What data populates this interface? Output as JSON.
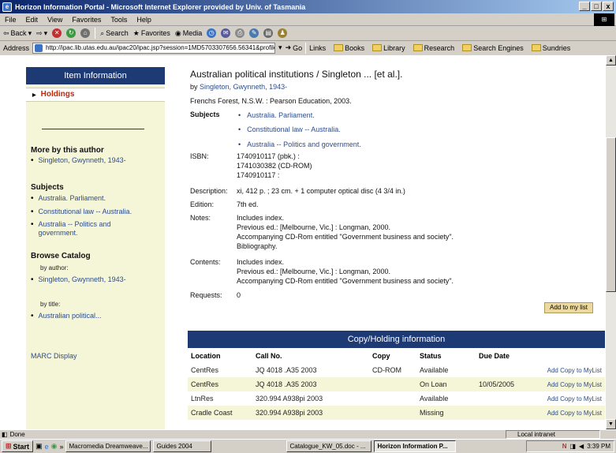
{
  "window": {
    "title": "Horizon Information Portal - Microsoft Internet Explorer provided by Univ. of Tasmania",
    "controls": [
      "_",
      "□",
      "x"
    ]
  },
  "menu": [
    "File",
    "Edit",
    "View",
    "Favorites",
    "Tools",
    "Help"
  ],
  "toolbar": {
    "back": "Back",
    "search": "Search",
    "favorites": "Favorites",
    "media": "Media"
  },
  "address": {
    "label": "Address",
    "url": "http://ipac.lib.utas.edu.au/ipac20/ipac.jsp?session=1MD5703307656.56341&profile=cent&uri=",
    "go": "Go",
    "links_label": "Links",
    "links": [
      "Books",
      "Library",
      "Research",
      "Search Engines",
      "Sundries"
    ]
  },
  "sidebar": {
    "header": "Item Information",
    "holdings": "Holdings",
    "more_by_author": "More by this author",
    "author_link": "Singleton, Gwynneth, 1943-",
    "subjects_heading": "Subjects",
    "subjects": [
      "Australia. Parliament.",
      "Constitutional law -- Australia.",
      "Australia -- Politics and government."
    ],
    "browse_heading": "Browse Catalog",
    "by_author_label": "by author:",
    "browse_author": "Singleton, Gwynneth, 1943-",
    "by_title_label": "by title:",
    "browse_title": "Australian political...",
    "marc": "MARC Display"
  },
  "record": {
    "title": "Australian political institutions / Singleton ... [et al.].",
    "by_label": "by",
    "author": "Singleton, Gwynneth, 1943-",
    "publication": "Frenchs Forest, N.S.W. : Pearson Education, 2003.",
    "subjects_label": "Subjects",
    "subjects": [
      "Australia. Parliament.",
      "Constitutional law -- Australia.",
      "Australia -- Politics and government."
    ],
    "isbn_label": "ISBN:",
    "isbn": [
      "1740910117 (pbk.) :",
      "1741030382 (CD-ROM)",
      "1740910117 :"
    ],
    "description_label": "Description:",
    "description": "xi, 412 p. ; 23 cm. + 1 computer optical disc (4 3/4 in.)",
    "edition_label": "Edition:",
    "edition": "7th ed.",
    "notes_label": "Notes:",
    "notes": [
      "Includes index.",
      "Previous ed.: [Melbourne, Vic.] : Longman, 2000.",
      "Accompanying CD-Rom entitled \"Government business and society\".",
      "Bibliography."
    ],
    "contents_label": "Contents:",
    "contents": [
      "Includes index.",
      "Previous ed.: [Melbourne, Vic.] : Longman, 2000.",
      "Accompanying CD-Rom entitled \"Government business and society\"."
    ],
    "requests_label": "Requests:",
    "requests": "0",
    "add_to_list": "Add to my list"
  },
  "copies": {
    "header": "Copy/Holding information",
    "columns": [
      "Location",
      "Call No.",
      "Copy",
      "Status",
      "Due Date",
      ""
    ],
    "rows": [
      {
        "location": "CentRes",
        "call_no": "JQ 4018 .A35 2003",
        "copy": "CD-ROM",
        "status": "Available",
        "due": "",
        "action": "Add Copy to MyList"
      },
      {
        "location": "CentRes",
        "call_no": "JQ 4018 .A35 2003",
        "copy": "",
        "status": "On Loan",
        "due": "10/05/2005",
        "action": "Add Copy to MyList"
      },
      {
        "location": "LtnRes",
        "call_no": "320.994 A938pi 2003",
        "copy": "",
        "status": "Available",
        "due": "",
        "action": "Add Copy to MyList"
      },
      {
        "location": "Cradle Coast",
        "call_no": "320.994 A938pi 2003",
        "copy": "",
        "status": "Missing",
        "due": "",
        "action": "Add Copy to MyList"
      }
    ]
  },
  "status": {
    "text": "Done",
    "zone": "Local intranet"
  },
  "taskbar": {
    "start": "Start",
    "tasks": [
      "Macromedia Dreamweave...",
      "Guides 2004",
      "Catalogue_KW_05.doc - ...",
      "Horizon Information P..."
    ],
    "clock": "3:39 PM"
  }
}
